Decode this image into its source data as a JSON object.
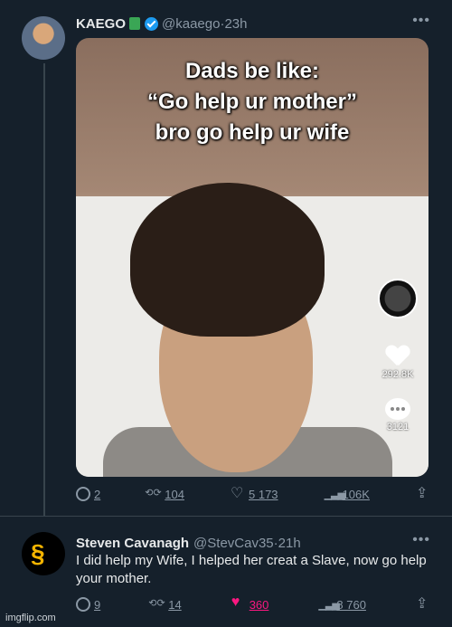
{
  "tweet1": {
    "name": "KAEGO",
    "handle": "@kaaego",
    "time": "23h",
    "media_caption": [
      "Dads be like:",
      "“Go help ur mother”",
      "bro go help ur wife"
    ],
    "tiktok_likes": "292.8K",
    "tiktok_comments": "3121",
    "actions": {
      "replies": "2",
      "reposts": "104",
      "likes": "5 173",
      "views": "106K"
    }
  },
  "tweet2": {
    "name": "Steven Cavanagh",
    "handle": "@StevCav35",
    "time": "21h",
    "text": "I did help my Wife, I helped her creat a Slave, now go help your mother.",
    "actions": {
      "replies": "9",
      "reposts": "14",
      "likes": "360",
      "views": "8 760"
    },
    "liked": true
  },
  "watermark": "imgflip.com",
  "colors": {
    "bg": "#15202b",
    "accent": "#1d9bf0",
    "like": "#f91880",
    "muted": "#8b98a5"
  }
}
